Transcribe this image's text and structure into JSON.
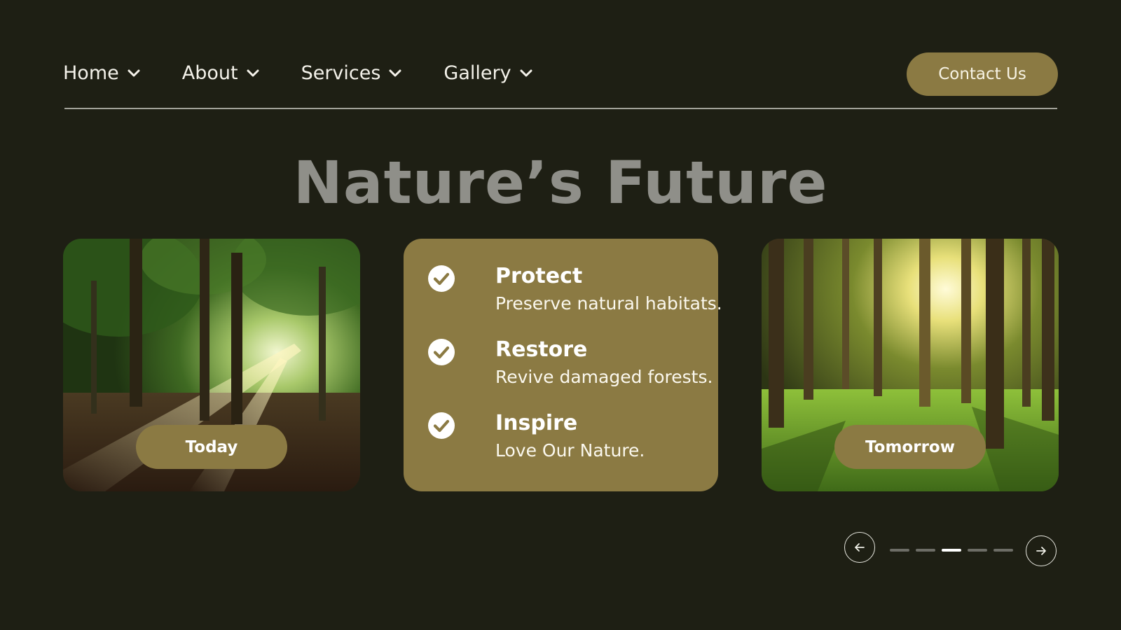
{
  "nav": {
    "items": [
      {
        "label": "Home"
      },
      {
        "label": "About"
      },
      {
        "label": "Services"
      },
      {
        "label": "Gallery"
      }
    ],
    "contact_label": "Contact Us"
  },
  "hero": {
    "title": "Nature’s Future"
  },
  "cards": {
    "left": {
      "pill_label": "Today"
    },
    "right": {
      "pill_label": "Tomorrow"
    }
  },
  "features": [
    {
      "title": "Protect",
      "desc": "Preserve natural habitats."
    },
    {
      "title": "Restore",
      "desc": "Revive damaged forests."
    },
    {
      "title": "Inspire",
      "desc": "Love Our Nature."
    }
  ],
  "carousel": {
    "total_slides": 5,
    "active_index": 2
  },
  "colors": {
    "background": "#1e1f14",
    "accent": "#8b7a43",
    "title": "#8f8f89"
  },
  "icons": {
    "chevron": "chevron-down-icon",
    "check": "check-circle-icon",
    "prev": "arrow-left-icon",
    "next": "arrow-right-icon"
  }
}
